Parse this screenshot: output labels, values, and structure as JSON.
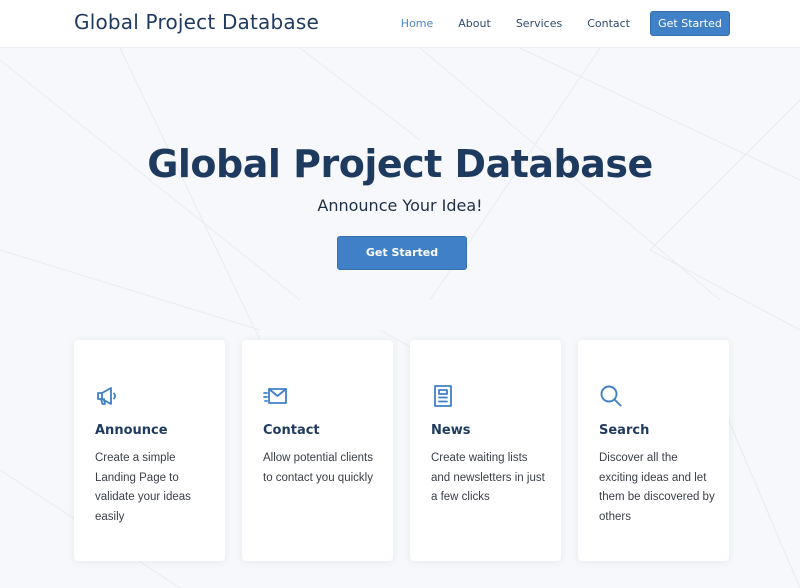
{
  "header": {
    "logo": "Global Project Database",
    "nav": [
      "Home",
      "About",
      "Services",
      "Contact"
    ],
    "cta": "Get Started"
  },
  "hero": {
    "title": "Global Project Database",
    "subtitle": "Announce Your Idea!",
    "cta": "Get Started"
  },
  "cards": [
    {
      "icon": "megaphone-icon",
      "title": "Announce",
      "text": "Create a simple Landing Page to validate your ideas easily"
    },
    {
      "icon": "mail-icon",
      "title": "Contact",
      "text": "Allow potential clients to contact you quickly"
    },
    {
      "icon": "newsletter-icon",
      "title": "News",
      "text": "Create waiting lists and newsletters in just a few clicks"
    },
    {
      "icon": "search-icon",
      "title": "Search",
      "text": "Discover all the exciting ideas and let them be discovered by others"
    }
  ],
  "colors": {
    "accent": "#3f80c7",
    "heading": "#1f3a5f",
    "active_nav": "#4a86c7"
  }
}
